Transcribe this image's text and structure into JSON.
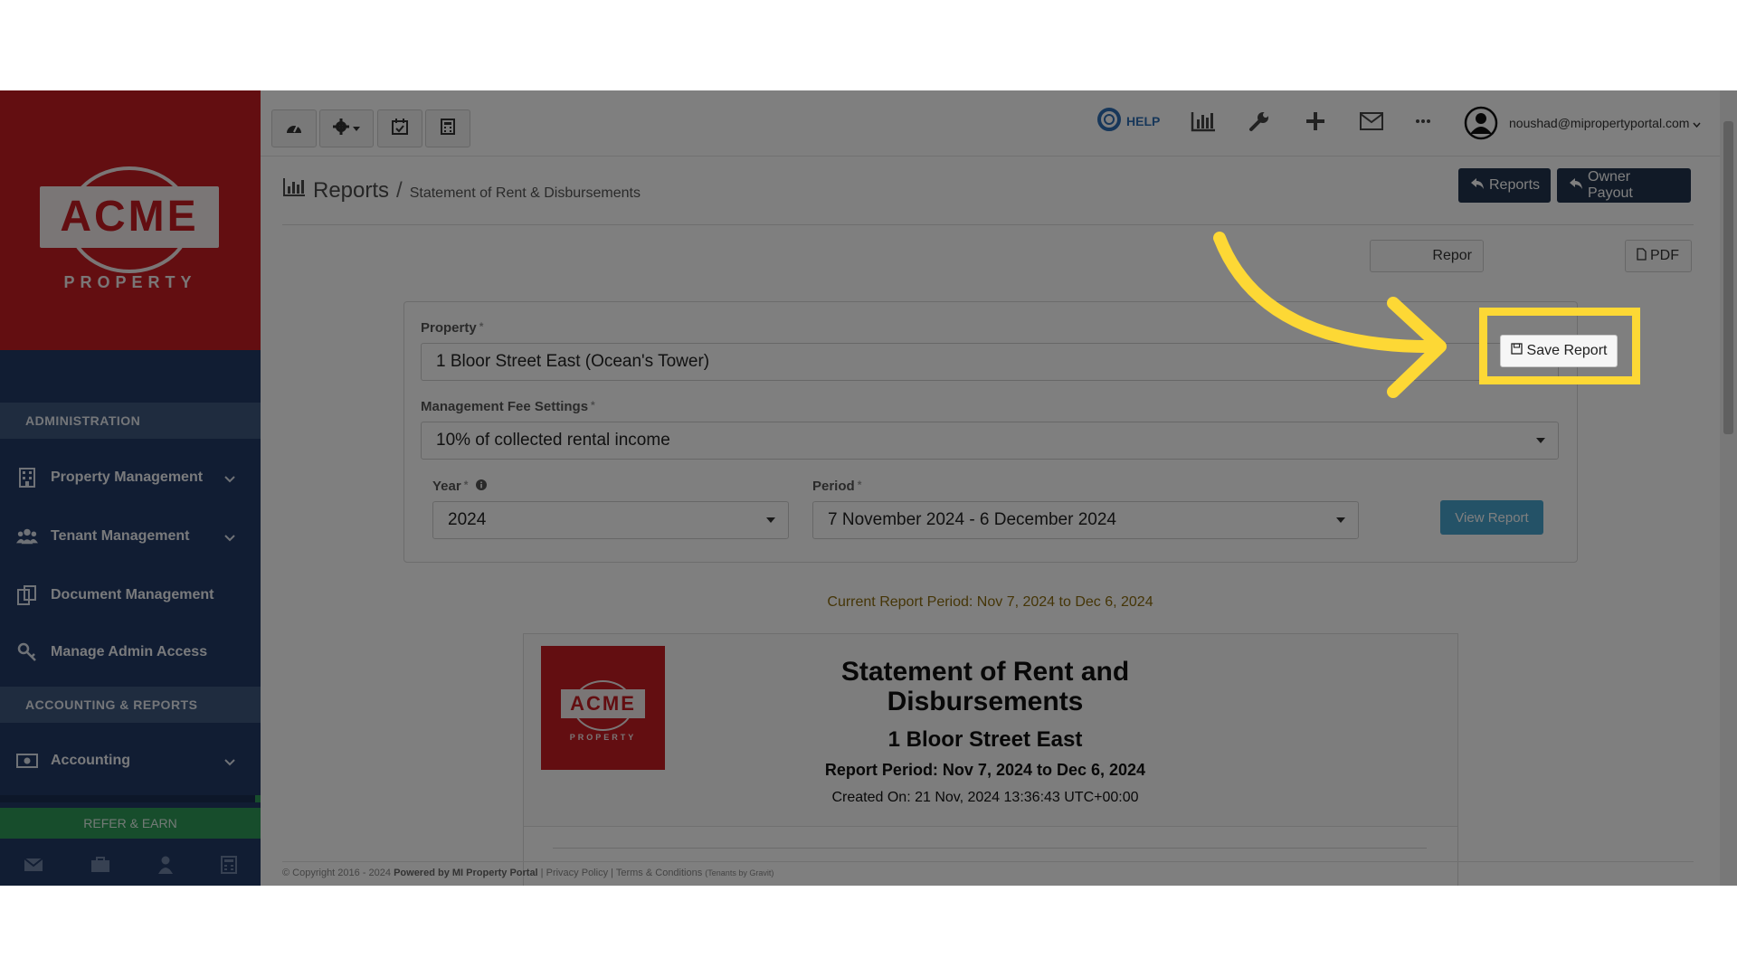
{
  "brand": {
    "logo_text": "ACME",
    "logo_sub": "PROPERTY"
  },
  "sidebar": {
    "sections": [
      {
        "label": "ADMINISTRATION"
      },
      {
        "label": "ACCOUNTING & REPORTS"
      }
    ],
    "items": [
      {
        "label": "Property Management",
        "icon": "building-icon"
      },
      {
        "label": "Tenant Management",
        "icon": "users-icon"
      },
      {
        "label": "Document Management",
        "icon": "documents-icon"
      },
      {
        "label": "Manage Admin Access",
        "icon": "key-icon"
      },
      {
        "label": "Accounting",
        "icon": "money-icon"
      }
    ],
    "refer_label": "REFER & EARN",
    "bottom_icons": [
      "envelope-icon",
      "briefcase-icon",
      "user-icon",
      "calculator-icon"
    ]
  },
  "topbar": {
    "help_label": "HELP",
    "user_email": "noushad@mipropertyportal.com"
  },
  "breadcrumb": {
    "title": "Reports",
    "separator": "/",
    "current": "Statement of Rent & Disbursements"
  },
  "header_buttons": {
    "reports": "Reports",
    "owner_payout": "Owner Payout"
  },
  "actions": {
    "report_partial": "Repor",
    "save_report": "Save Report",
    "pdf": "PDF"
  },
  "form": {
    "property_label": "Property",
    "property_value": "1 Bloor Street East (Ocean's Tower)",
    "fee_label": "Management Fee Settings",
    "fee_value": "10% of collected rental income",
    "year_label": "Year",
    "year_value": "2024",
    "period_label": "Period",
    "period_value": "7 November 2024 - 6 December 2024",
    "required_mark": "*",
    "view_button": "View Report"
  },
  "current_period": "Current Report Period: Nov 7, 2024 to Dec 6, 2024",
  "report": {
    "title": "Statement of Rent and Disbursements",
    "property": "1 Bloor Street East",
    "period": "Report Period: Nov 7, 2024 to Dec 6, 2024",
    "created": "Created On: 21 Nov, 2024 13:36:43 UTC+00:00"
  },
  "footer": {
    "copyright": "© Copyright 2016 - 2024",
    "powered": "Powered by MI Property Portal",
    "privacy": "Privacy Policy",
    "terms": "Terms & Conditions",
    "tenants": "(Tenants by Gravit)"
  },
  "colors": {
    "brand_red": "#c61c22",
    "sidebar_navy": "#233a66",
    "highlight_yellow": "#fdd835",
    "view_button": "#49a4cf"
  }
}
